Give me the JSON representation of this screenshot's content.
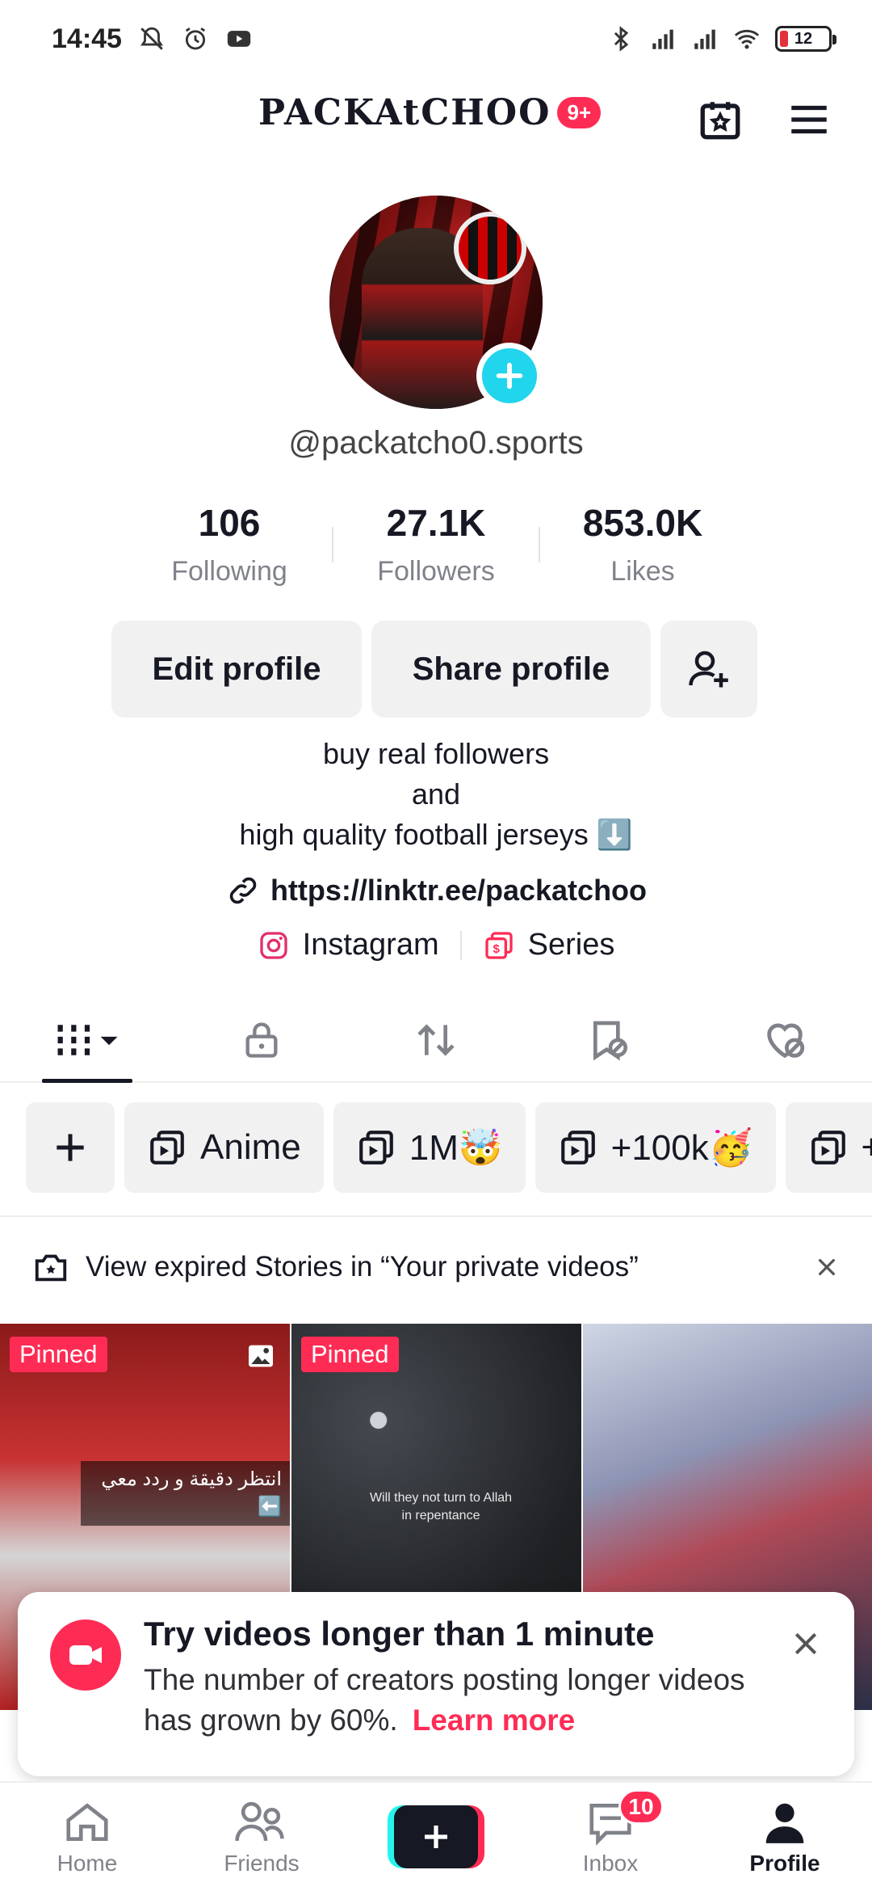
{
  "status_bar": {
    "time": "14:45",
    "battery": "12"
  },
  "header": {
    "brand": "PACKAtCHOO",
    "notification_badge": "9+"
  },
  "profile": {
    "username": "@packatcho0.sports",
    "stats": [
      {
        "value": "106",
        "label": "Following"
      },
      {
        "value": "27.1K",
        "label": "Followers"
      },
      {
        "value": "853.0K",
        "label": "Likes"
      }
    ],
    "buttons": {
      "edit": "Edit profile",
      "share": "Share profile"
    },
    "bio": {
      "line1": "buy real followers",
      "line2": "and",
      "line3": "high quality football jerseys ⬇️"
    },
    "link": "https://linktr.ee/packatchoo",
    "socials": {
      "instagram": "Instagram",
      "series": "Series"
    }
  },
  "playlists": [
    {
      "label": "Anime"
    },
    {
      "label": "1M🤯"
    },
    {
      "label": "+100k🥳"
    },
    {
      "label": "+"
    }
  ],
  "stories_notice": "View expired Stories in “Your private videos”",
  "videos": [
    {
      "pinned": "Pinned",
      "overlay": "انتظر دقيقة و ردد معي ⬅️"
    },
    {
      "pinned": "Pinned",
      "overlay": "Will they not turn to Allah in repentance"
    },
    {
      "pinned": "",
      "overlay": ""
    }
  ],
  "promo": {
    "title": "Try videos longer than 1 minute",
    "body": "The number of creators posting longer videos has grown by 60%.",
    "link": "Learn more"
  },
  "nav": {
    "home": "Home",
    "friends": "Friends",
    "inbox": "Inbox",
    "inbox_badge": "10",
    "profile": "Profile"
  },
  "colors": {
    "accent": "#fe2c55",
    "cyan": "#20d5ec",
    "text": "#161823"
  }
}
